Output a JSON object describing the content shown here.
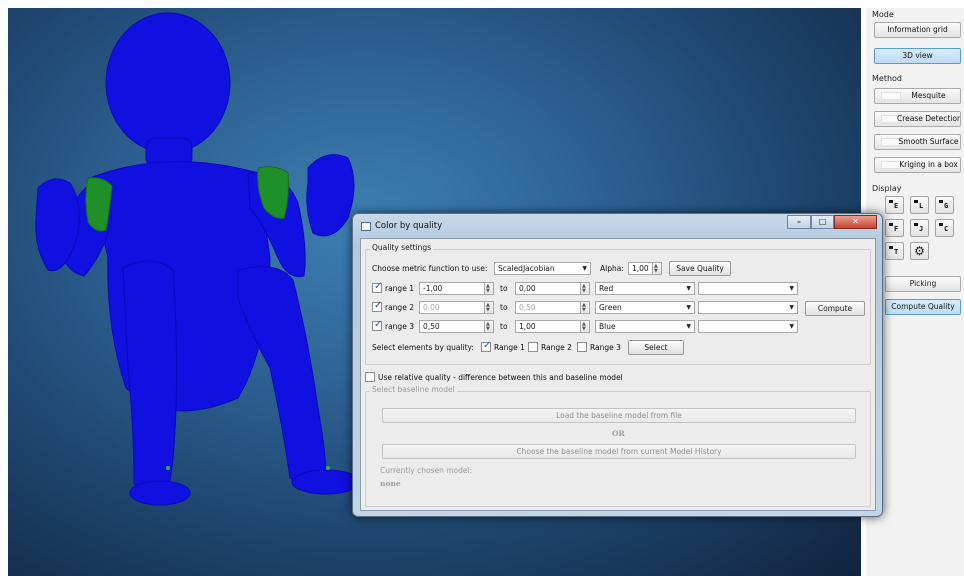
{
  "side_panel": {
    "mode": {
      "label": "Mode",
      "buttons": [
        {
          "label": "Information grid",
          "active": false
        },
        {
          "label": "3D view",
          "active": true
        }
      ]
    },
    "method": {
      "label": "Method",
      "buttons": [
        {
          "label": "Mesquite"
        },
        {
          "label": "Crease Detection"
        },
        {
          "label": "Smooth Surface"
        },
        {
          "label": "Kriging in a box"
        }
      ]
    },
    "display": {
      "label": "Display",
      "buttons": [
        "E",
        "L",
        "G",
        "F",
        "J",
        "C",
        "T"
      ]
    },
    "picking_label": "Picking",
    "compute_quality_label": "Compute Quality"
  },
  "dialog": {
    "title": "Color by quality",
    "quality_settings": {
      "group_title": "Quality settings",
      "metric_label": "Choose metric function to use:",
      "metric_value": "ScaledJacobian",
      "alpha_label": "Alpha:",
      "alpha_value": "1,00",
      "save_button": "Save Quality",
      "to_label": "to",
      "ranges": [
        {
          "label": "range 1",
          "checked": true,
          "from": "-1,00",
          "to": "0,00",
          "color": "Red",
          "enabled": true
        },
        {
          "label": "range 2",
          "checked": true,
          "from": "0,00",
          "to": "0,50",
          "color": "Green",
          "enabled": false
        },
        {
          "label": "range 3",
          "checked": true,
          "from": "0,50",
          "to": "1,00",
          "color": "Blue",
          "enabled": true
        }
      ],
      "compute_button": "Compute",
      "select_label": "Select elements by quality:",
      "select_checks": [
        {
          "label": "Range 1",
          "checked": true
        },
        {
          "label": "Range 2",
          "checked": false
        },
        {
          "label": "Range 3",
          "checked": false
        }
      ],
      "select_button": "Select"
    },
    "relative": {
      "label": "Use relative quality - difference between this and baseline model",
      "checked": false
    },
    "baseline": {
      "group_title": "Select baseline model",
      "load_button": "Load the baseline model from file",
      "or_label": "OR",
      "history_button": "Choose the baseline model from current Model History",
      "current_label": "Currently chosen model:",
      "current_value": "none"
    }
  },
  "colors": {
    "mesh_blue": "#1010e0",
    "mesh_green": "#1f8f2a",
    "background": "#2f6597",
    "accent": "#5b9bd5"
  }
}
